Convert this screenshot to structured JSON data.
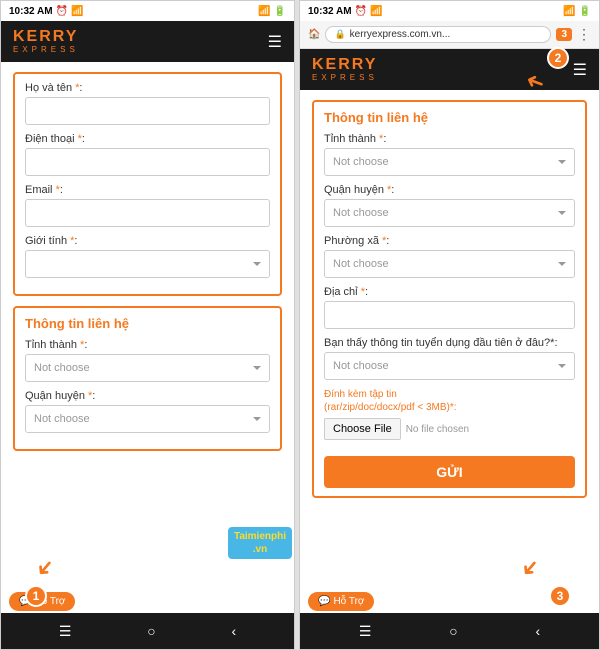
{
  "left_panel": {
    "status_time": "10:32 AM",
    "header_title": "KERRY",
    "header_sub": "EXPRESS",
    "form_section": {
      "title": "",
      "fields": [
        {
          "label": "Họ và tên *:",
          "type": "input",
          "placeholder": ""
        },
        {
          "label": "Điện thoại *:",
          "type": "input",
          "placeholder": ""
        },
        {
          "label": "Email *:",
          "type": "input",
          "placeholder": ""
        },
        {
          "label": "Giới tính *:",
          "type": "select",
          "placeholder": ""
        }
      ]
    },
    "contact_section": {
      "title": "Thông tin liên hệ",
      "fields": [
        {
          "label": "Tỉnh thành *:",
          "type": "select",
          "placeholder": "Not choose"
        },
        {
          "label": "Quận huyện *:",
          "type": "select",
          "placeholder": "Not choose"
        }
      ]
    },
    "support_btn": "Hỗ Trợ",
    "badge1": "1"
  },
  "right_panel": {
    "status_time": "10:32 AM",
    "url": "kerryexpress.com.vn...",
    "header_title": "KERRY",
    "header_sub": "EXPRESS",
    "contact_section": {
      "title": "Thông tin liên hệ",
      "fields": [
        {
          "label": "Tỉnh thành *:",
          "type": "select",
          "placeholder": "Not choose"
        },
        {
          "label": "Quận huyện *:",
          "type": "select",
          "placeholder": "Not choose"
        },
        {
          "label": "Phường xã *:",
          "type": "select",
          "placeholder": "Not choose"
        },
        {
          "label": "Địa chỉ *:",
          "type": "input",
          "placeholder": ""
        }
      ]
    },
    "question_label": "Bạn thấy thông tin tuyển dụng đầu tiên ở đâu?*:",
    "question_select_placeholder": "Not choose",
    "attachment_label": "Đính kèm tập tin",
    "attachment_sub": "(rar/zip/doc/docx/pdf < 3MB)*:",
    "choose_file_btn": "Choose File",
    "no_file_chosen": "No file chosen",
    "submit_btn": "GỬI",
    "support_btn": "Hỗ Trợ",
    "badge2": "2",
    "badge3": "3"
  },
  "watermark": {
    "line1": "Taimienphi",
    "line2": ".vn"
  }
}
